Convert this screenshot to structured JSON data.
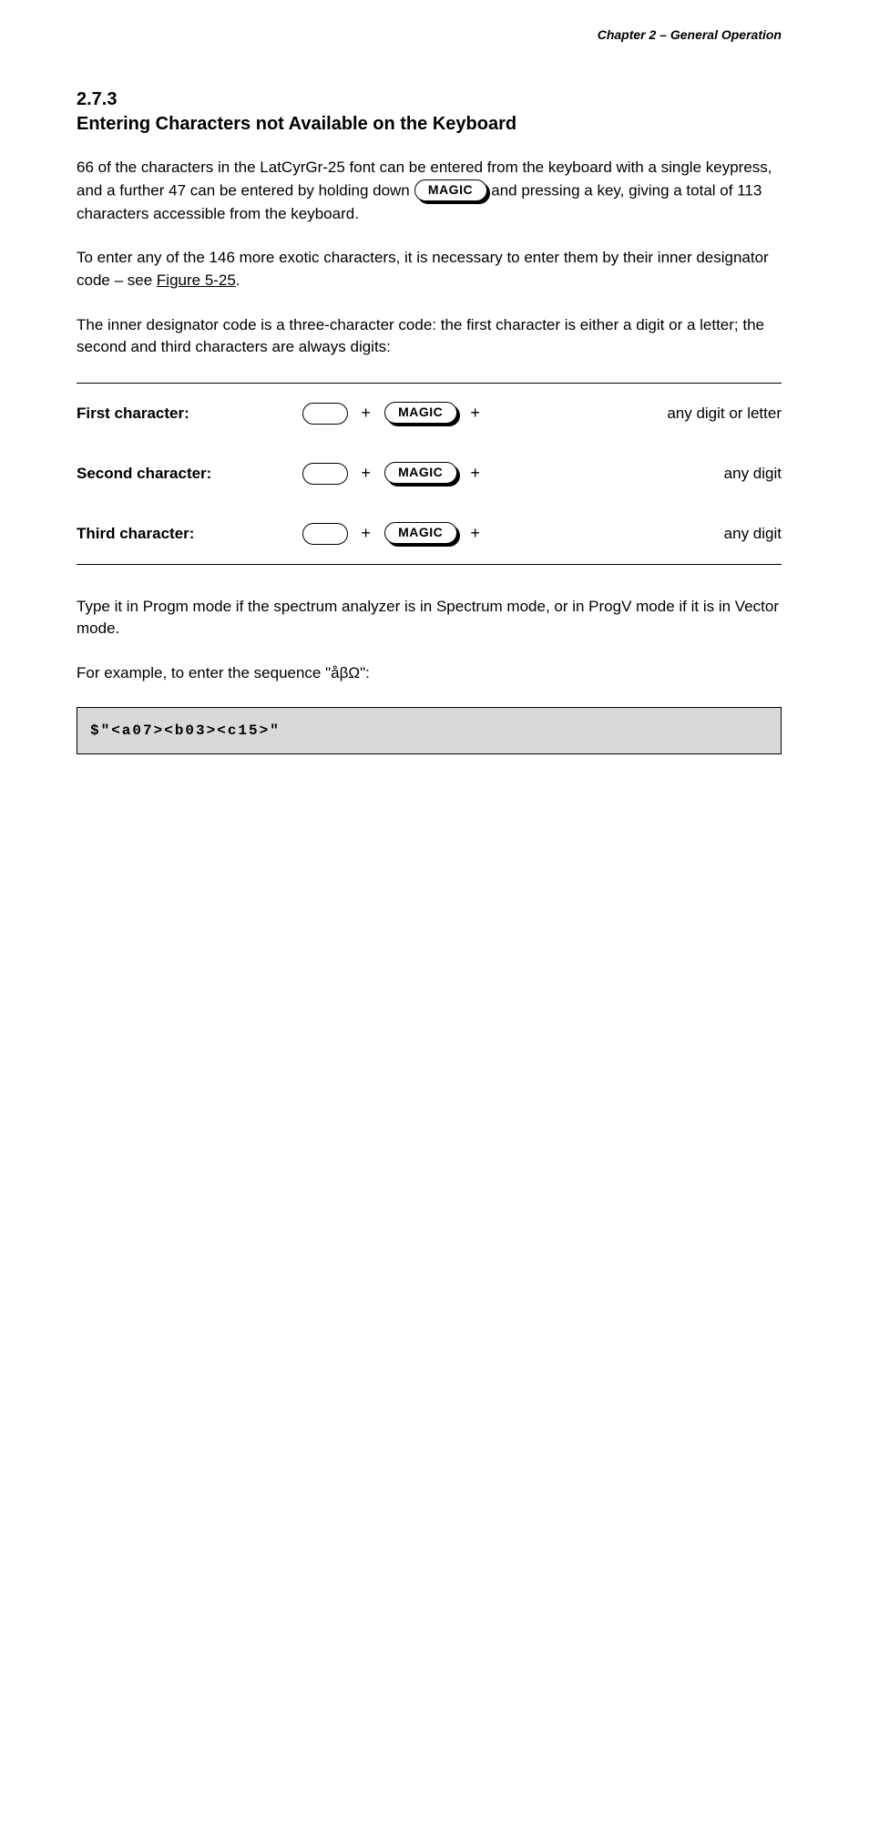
{
  "header": {
    "title": "Chapter 2 – General Operation"
  },
  "section": {
    "number": "2.7.3",
    "title": "Entering Characters not Available on the Keyboard"
  },
  "paragraphs": {
    "intro1": "66 of the characters in the LatCyrGr-25 font can be entered from the keyboard with a single keypress, and a further 47 can be entered by holding down ",
    "intro2": " and pressing a key, giving a total of 113 characters accessible from the keyboard.",
    "exotic": "To enter any of the 146 more exotic characters, it is necessary to enter them by their inner designator code – see ",
    "figref": "Figure 5-25",
    "exotic_tail": ".",
    "designator_intro": "The inner designator code is a three-character code: the first character is either a digit or a letter; the second and third characters are always digits:",
    "mode_note": "Type it in Progm mode if the spectrum analyzer is in Spectrum mode, or in ProgV mode if it is in Vector mode.",
    "example_lead": "For example, to enter the sequence \"åβΩ\":"
  },
  "table": {
    "caption": "",
    "col_keys_plus": "+",
    "rows": [
      {
        "label": "First character:",
        "pill1": "blank",
        "pill2": "MAGIC",
        "desc": "any digit or letter"
      },
      {
        "label": "Second character:",
        "pill1": "blank",
        "pill2": "MAGIC",
        "desc": "any digit"
      },
      {
        "label": "Third character:",
        "pill1": "blank",
        "pill2": "MAGIC",
        "desc": "any digit"
      }
    ]
  },
  "example": {
    "text": "$\"<a07><b03><c15>\""
  }
}
